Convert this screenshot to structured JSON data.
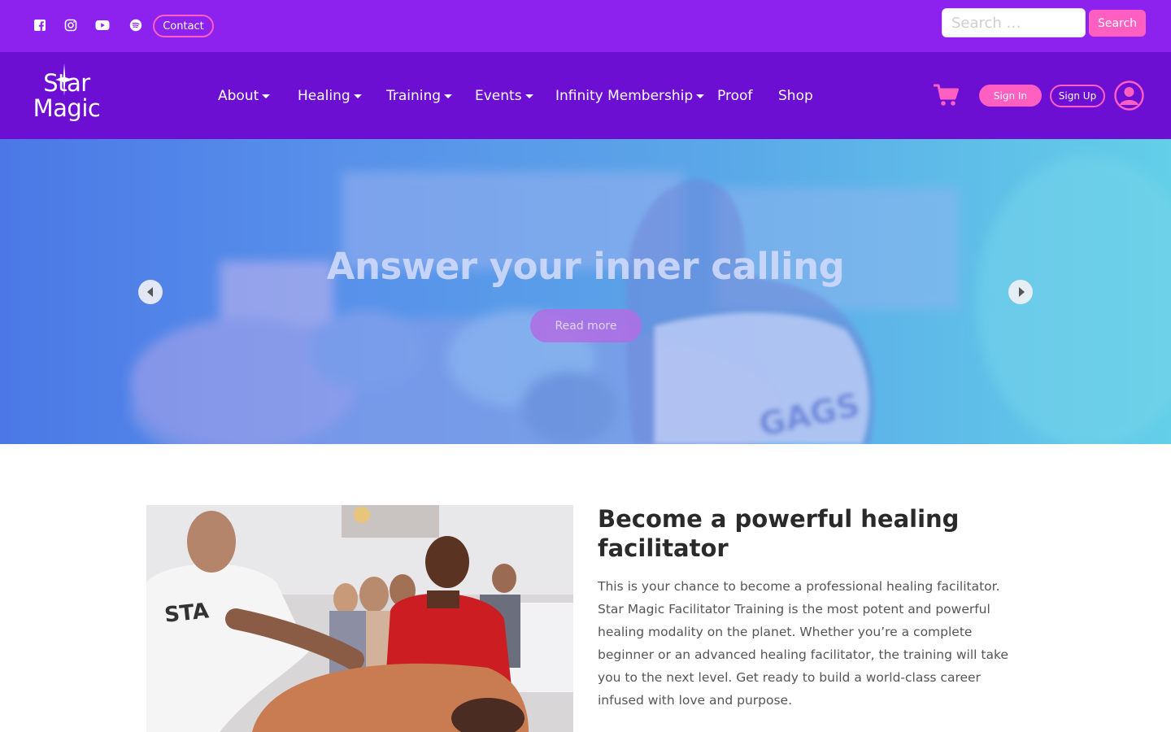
{
  "topbar": {
    "social_icons": [
      "facebook-icon",
      "instagram-icon",
      "youtube-icon",
      "spotify-icon"
    ],
    "contact_label": "Contact",
    "search_placeholder": "Search …",
    "search_button": "Search"
  },
  "navbar": {
    "logo": {
      "line1": "Star",
      "line2": "Magic"
    },
    "items": [
      {
        "label": "About",
        "dropdown": true
      },
      {
        "label": "Healing",
        "dropdown": true
      },
      {
        "label": "Training",
        "dropdown": true
      },
      {
        "label": "Events",
        "dropdown": true
      },
      {
        "label": "Infinity Membership",
        "dropdown": true
      },
      {
        "label": "Proof",
        "dropdown": false
      },
      {
        "label": "Shop",
        "dropdown": false
      }
    ],
    "cart_icon": "shopping-cart-icon",
    "signin_label": "Sign In",
    "signup_label": "Sign Up",
    "user_icon": "user-avatar-icon"
  },
  "hero": {
    "title": "Answer your inner calling",
    "button_label": "Read more",
    "prev_icon": "arrow-left-icon",
    "next_icon": "arrow-right-icon"
  },
  "intro": {
    "heading": "Become a powerful healing facilitator",
    "body": "This is your chance to become a professional healing facilitator. Star Magic Facilitator Training is the most potent and powerful healing modality on the planet. Whether you’re a complete beginner or an advanced healing facilitator, the training will take you to the next level. Get ready to build a world-class career infused with love and purpose."
  },
  "colors": {
    "topbar": "#8d22ee",
    "navbar": "#6d0ed3",
    "accent_pink": "#ff5fc1",
    "hero_left": "#4b78e6",
    "hero_right": "#63cfe8"
  }
}
